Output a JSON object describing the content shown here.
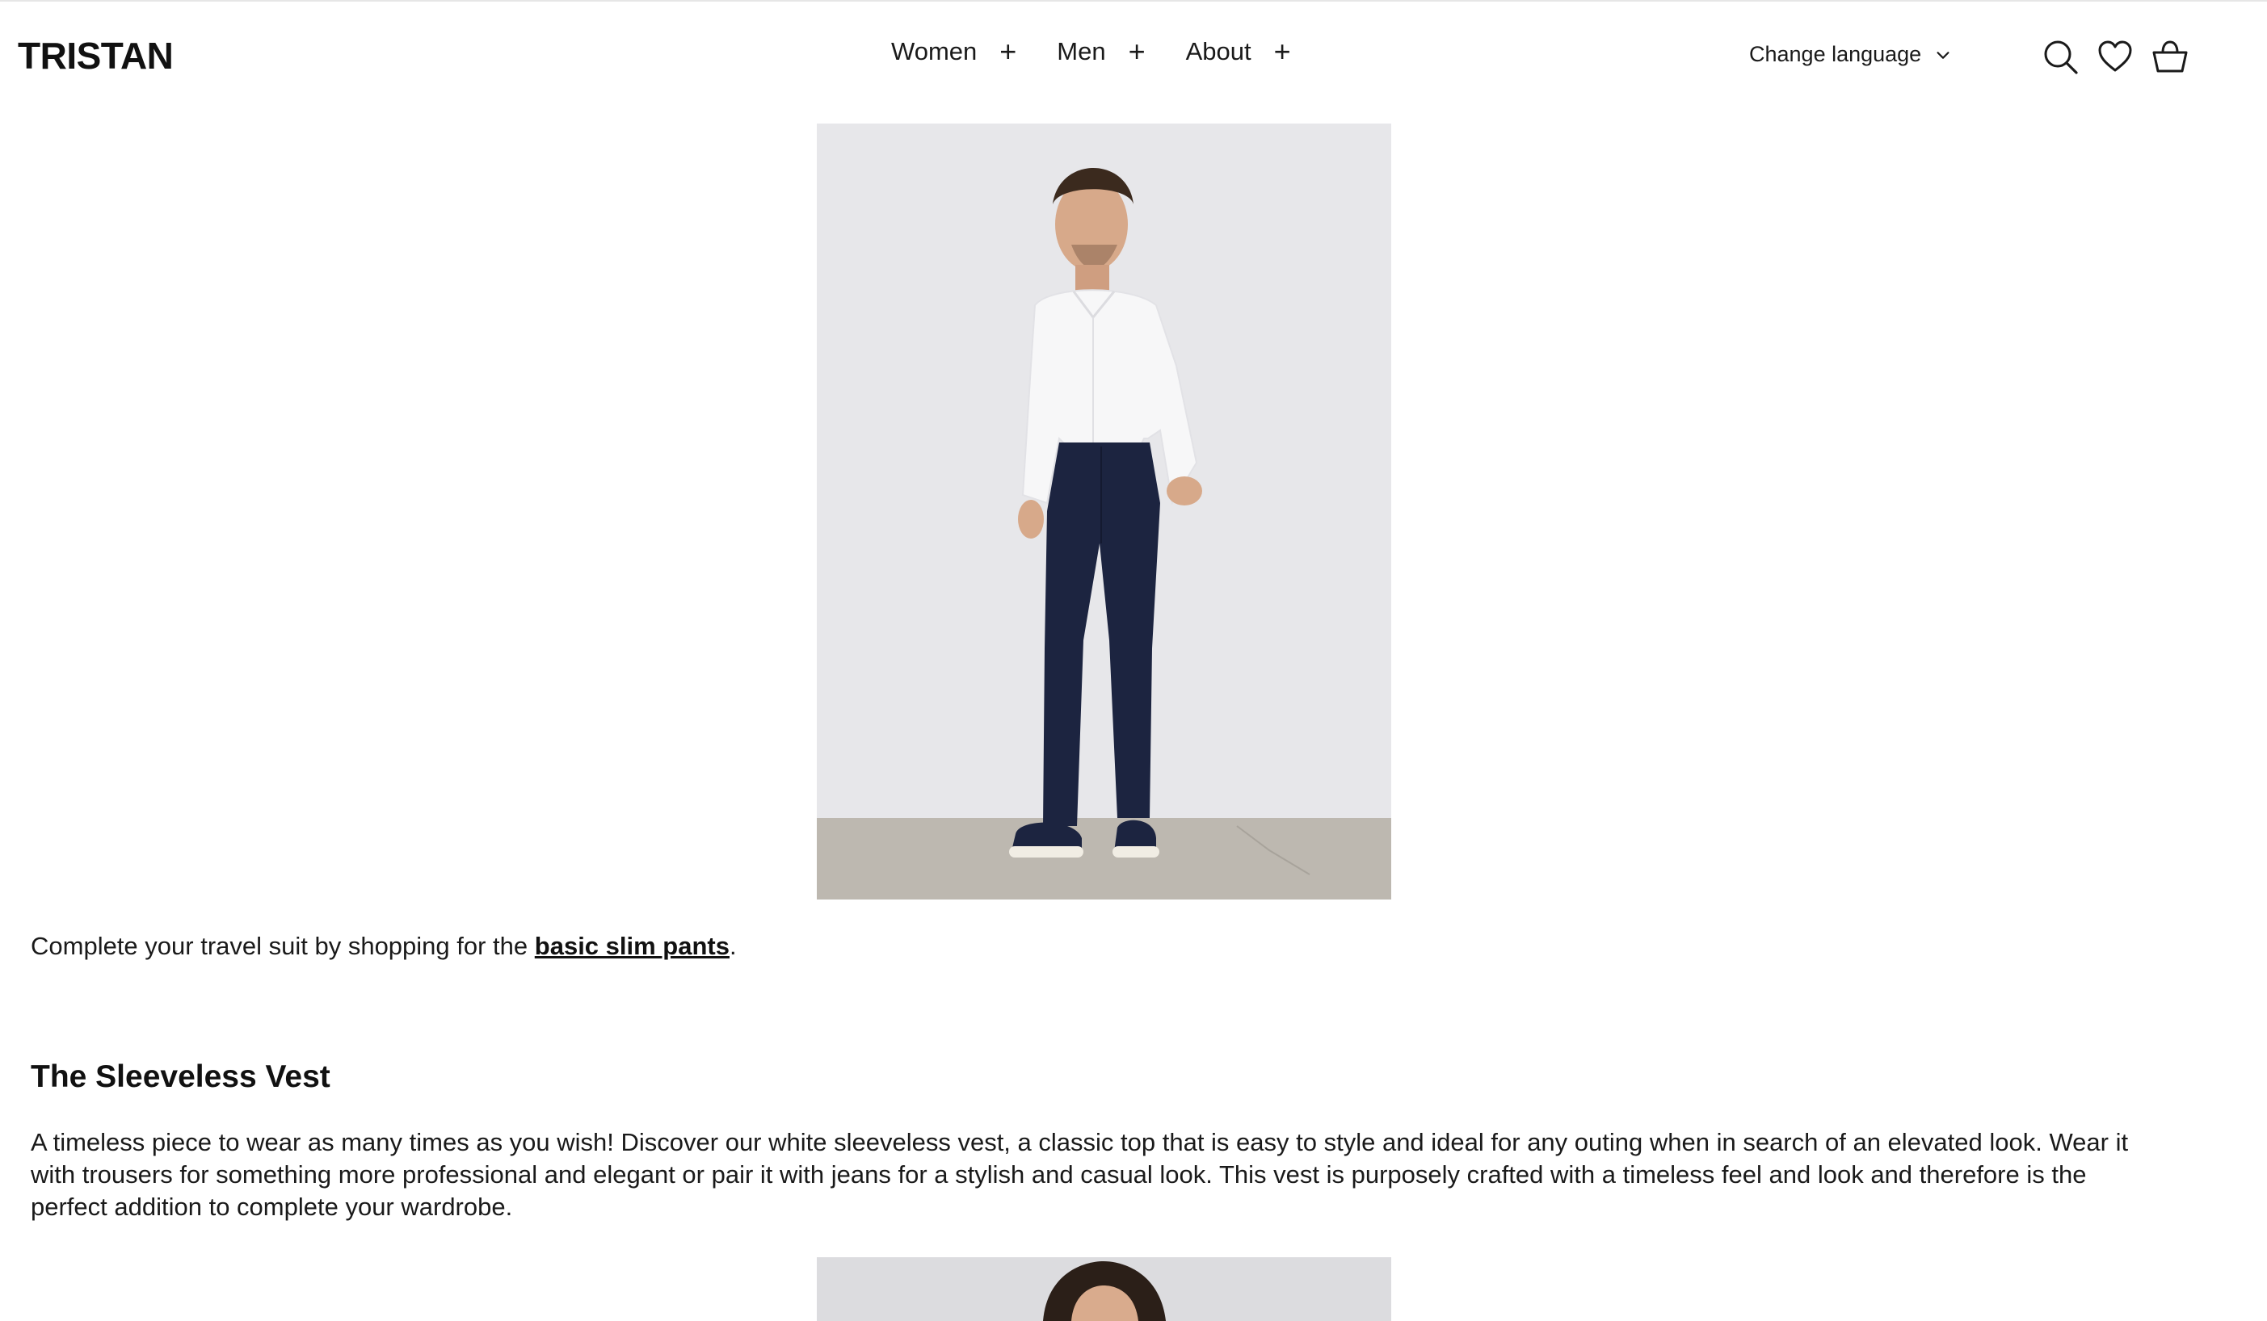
{
  "header": {
    "logo": "TRISTAN",
    "nav": [
      {
        "label": "Women",
        "expand": "+"
      },
      {
        "label": "Men",
        "expand": "+"
      },
      {
        "label": "About",
        "expand": "+"
      }
    ],
    "language_label": "Change language",
    "icons": [
      "search-icon",
      "heart-icon",
      "basket-icon"
    ]
  },
  "content": {
    "travel_suit_text_before": "Complete your travel suit by shopping for the ",
    "travel_suit_link": "basic slim pants",
    "travel_suit_text_after": ".",
    "vest_heading": "The Sleeveless Vest",
    "vest_paragraph": "A timeless piece to wear as many times as you wish! Discover our white sleeveless vest, a classic top that is easy to style and ideal for any outing when in search of an elevated look. Wear it with trousers for something more professional and elegant or pair it with jeans for a stylish and casual look. This vest is purposely crafted with a timeless feel and look and therefore is the perfect addition to complete your wardrobe."
  },
  "colors": {
    "text": "#1a1a1a",
    "photo_background": "#e6e6e8",
    "floor": "#bdb8b0",
    "pants": "#1c2440"
  }
}
